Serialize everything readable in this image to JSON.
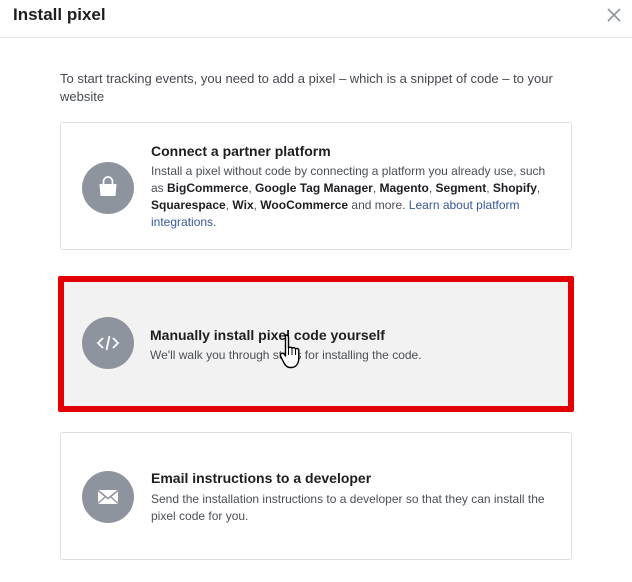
{
  "dialog": {
    "title": "Install pixel",
    "close_label": "close"
  },
  "intro": "To start tracking events, you need to add a pixel – which is a snippet of code – to your website",
  "options": {
    "partner": {
      "title": "Connect a partner platform",
      "desc_prefix": "Install a pixel without code by connecting a platform you already use, such as ",
      "platforms": [
        "BigCommerce",
        "Google Tag Manager",
        "Magento",
        "Segment",
        "Shopify",
        "Squarespace",
        "Wix",
        "WooCommerce"
      ],
      "sep": ", ",
      "desc_suffix": " and more. ",
      "link": "Learn about platform integrations",
      "link_end": ".",
      "icon": "shopping-bag-icon"
    },
    "manual": {
      "title": "Manually install pixel code yourself",
      "desc": "We'll walk you through steps for installing the code.",
      "icon": "code-icon"
    },
    "email": {
      "title": "Email instructions to a developer",
      "desc": "Send the installation instructions to a developer so that they can install the pixel code for you.",
      "icon": "envelope-icon"
    }
  },
  "colors": {
    "highlight": "#e50000",
    "icon_bg": "#8d949e",
    "link": "#365899"
  }
}
